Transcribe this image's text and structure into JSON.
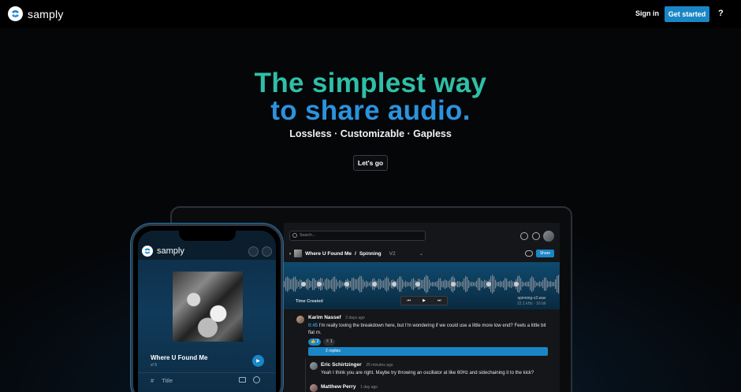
{
  "nav": {
    "brand": "samply",
    "signin_label": "Sign in",
    "getstarted_label": "Get started",
    "help_label": "?"
  },
  "hero": {
    "line1": "The simplest way",
    "line2": "to share audio.",
    "tagline": "Lossless · Customizable · Gapless",
    "cta_label": "Let's go"
  },
  "colors": {
    "accent": "#1a86c6",
    "hero_teal": "#2fbfa8",
    "hero_blue": "#2b93de"
  },
  "desktop": {
    "search_placeholder": "Search...",
    "breadcrumb": {
      "project": "Where U Found Me",
      "separator": "/",
      "track": "Spinning",
      "version": "V2"
    },
    "share_label": "Share",
    "time_created_label": "Time Created",
    "file": {
      "name": "spinning-v2.wav",
      "meta": "22.1 kHz · 16 bit"
    },
    "comments": [
      {
        "author": "Karim Nassef",
        "time": "2 days ago",
        "timestamp": "0:45",
        "text": "I'm really loving the breakdown here, but I'm wondering if we could use a little more low end? Feels a little bit",
        "text2": "flat rn."
      },
      {
        "author": "Eric Schirtzinger",
        "time": "25 minutes ago",
        "text": "Yeah I think you are right. Maybe try throwing an oscillator at like 60Hz and sidechaining it to the kick?"
      },
      {
        "author": "Matthew Perry",
        "time": "1 day ago"
      }
    ],
    "reactions": [
      "👍 2",
      "✌ 1"
    ],
    "replies_label": "2 replies"
  },
  "mobile": {
    "brand": "samply",
    "track_title": "Where U Found Me",
    "track_sub": "v/ 5",
    "column_hash": "#",
    "column_title": "Title"
  }
}
